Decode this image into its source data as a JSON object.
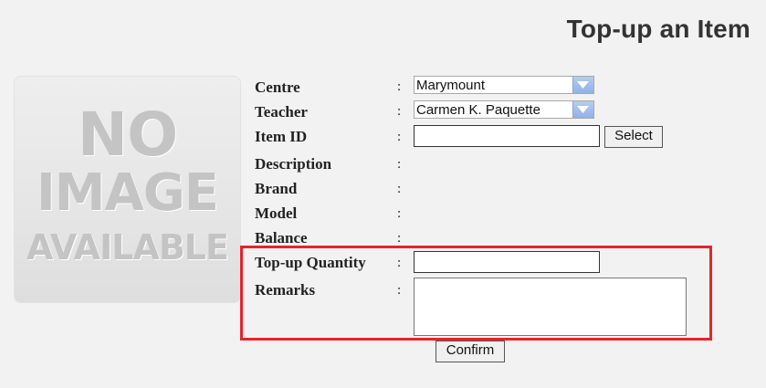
{
  "page": {
    "title": "Top-up an Item"
  },
  "placeholder_image": {
    "line1": "NO",
    "line2": "IMAGE",
    "line3": "AVAILABLE"
  },
  "form": {
    "separator": ":",
    "centre": {
      "label": "Centre",
      "value": "Marymount"
    },
    "teacher": {
      "label": "Teacher",
      "value": "Carmen K. Paquette"
    },
    "item_id": {
      "label": "Item ID",
      "value": "",
      "button": "Select"
    },
    "description": {
      "label": "Description",
      "value": ""
    },
    "brand": {
      "label": "Brand",
      "value": ""
    },
    "model": {
      "label": "Model",
      "value": ""
    },
    "balance": {
      "label": "Balance",
      "value": ""
    },
    "topup_quantity": {
      "label": "Top-up Quantity",
      "value": ""
    },
    "remarks": {
      "label": "Remarks",
      "value": ""
    },
    "confirm_button": "Confirm"
  },
  "colors": {
    "highlight_border": "#e8232b",
    "dropdown_arrow": "#8fb2e8",
    "background": "#f2f2f2"
  },
  "icons": {
    "dropdown": "chevron-down-icon"
  }
}
